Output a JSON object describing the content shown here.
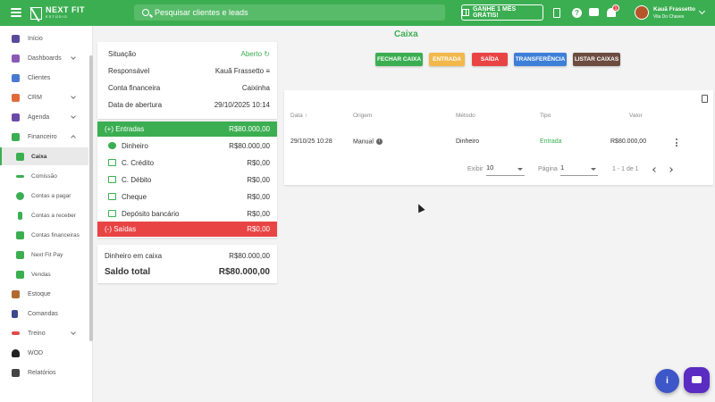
{
  "topbar": {
    "logo_main": "NEXT FIT",
    "logo_sub": "ESTÚDIO",
    "search_placeholder": "Pesquisar clientes e leads",
    "promo_label": "GANHE 1 MÊS GRÁTIS!",
    "help_glyph": "?",
    "notification_count": "1",
    "user_name": "Kauã Frassetto",
    "user_location": "Vila Do Chaves",
    "accent_color": "#3cae52"
  },
  "sidebar": {
    "items": [
      {
        "label": "Início",
        "icon": "home-icon",
        "color": "#5a4a9a"
      },
      {
        "label": "Dashboards",
        "icon": "chart-icon",
        "color": "#8a5ab8"
      },
      {
        "label": "Clientes",
        "icon": "users-icon",
        "color": "#4a7ad0"
      },
      {
        "label": "CRM",
        "icon": "network-icon",
        "color": "#e06a3a"
      },
      {
        "label": "Agenda",
        "icon": "calendar-icon",
        "color": "#6a4aa8"
      },
      {
        "label": "Financeiro",
        "icon": "money-icon",
        "color": "#3cae52"
      },
      {
        "label": "Caixa",
        "icon": "cash-icon",
        "color": "#3cae52"
      },
      {
        "label": "Comissão",
        "icon": "trend-icon",
        "color": "#3cae52"
      },
      {
        "label": "Contas a pagar",
        "icon": "coin-icon",
        "color": "#3cae52"
      },
      {
        "label": "Contas a receber",
        "icon": "dollar-icon",
        "color": "#3cae52"
      },
      {
        "label": "Contas financeiras",
        "icon": "wallet-icon",
        "color": "#3cae52"
      },
      {
        "label": "Next Fit Pay",
        "icon": "pay-icon",
        "color": "#3cae52"
      },
      {
        "label": "Vendas",
        "icon": "cart-icon",
        "color": "#3cae52"
      },
      {
        "label": "Estoque",
        "icon": "cart-icon",
        "color": "#b06a30"
      },
      {
        "label": "Comandas",
        "icon": "receipt-icon",
        "color": "#3a4a8a"
      },
      {
        "label": "Treino",
        "icon": "dumbbell-icon",
        "color": "#e04a4a"
      },
      {
        "label": "WOD",
        "icon": "kettlebell-icon",
        "color": "#222222"
      },
      {
        "label": "Relatórios",
        "icon": "report-icon",
        "color": "#444444"
      }
    ]
  },
  "summary": {
    "situacao_label": "Situação",
    "situacao_value": "Aberto",
    "responsavel_label": "Responsável",
    "responsavel_value": "Kauã Frassetto",
    "conta_label": "Conta financeira",
    "conta_value": "Caixinha",
    "abertura_label": "Data de abertura",
    "abertura_value": "29/10/2025 10:14",
    "entradas_label": "(+) Entradas",
    "entradas_value": "R$80.000,00",
    "methods": [
      {
        "label": "Dinheiro",
        "value": "R$80.000,00"
      },
      {
        "label": "C. Crédito",
        "value": "R$0,00"
      },
      {
        "label": "C. Débito",
        "value": "R$0,00"
      },
      {
        "label": "Cheque",
        "value": "R$0,00"
      },
      {
        "label": "Depósito bancário",
        "value": "R$0,00"
      }
    ],
    "saidas_label": "(-) Saídas",
    "saidas_value": "R$0,00",
    "dinheiro_caixa_label": "Dinheiro em caixa",
    "dinheiro_caixa_value": "R$80.000,00",
    "saldo_label": "Saldo total",
    "saldo_value": "R$80.000,00"
  },
  "main": {
    "title": "Caixa",
    "buttons": [
      {
        "label": "FECHAR CAIXA",
        "color": "#3cae52"
      },
      {
        "label": "ENTRADA",
        "color": "#f2b84b"
      },
      {
        "label": "SAÍDA",
        "color": "#e94444"
      },
      {
        "label": "TRANSFERÊNCIA",
        "color": "#3e7fd8"
      },
      {
        "label": "LISTAR CAIXAS",
        "color": "#6d4c41"
      }
    ],
    "table": {
      "headers": {
        "data": "Data",
        "sort_arrow": "↑",
        "origem": "Origem",
        "metodo": "Método",
        "tipo": "Tipo",
        "valor": "Valor"
      },
      "rows": [
        {
          "data": "29/10/25 10:28",
          "origem": "Manual",
          "info_glyph": "i",
          "metodo": "Dinheiro",
          "tipo": "Entrada",
          "valor": "R$80.000,00"
        }
      ]
    },
    "pager": {
      "exibir_label": "Exibir",
      "exibir_value": "10",
      "pagina_label": "Página",
      "pagina_value": "1",
      "range": "1 - 1 de 1"
    }
  }
}
